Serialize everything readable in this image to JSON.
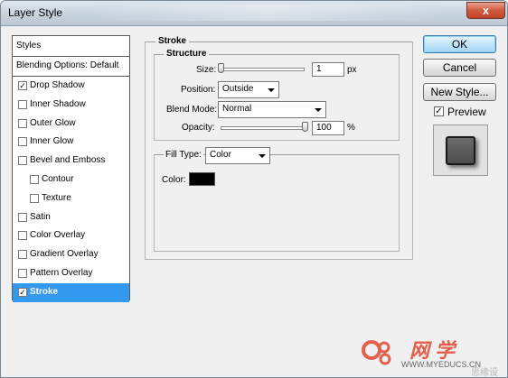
{
  "window": {
    "title": "Layer Style",
    "close_glyph": "x"
  },
  "styles_list": {
    "header": "Styles",
    "blending_options": "Blending Options: Default",
    "items": [
      {
        "label": "Drop Shadow",
        "checked": true,
        "sub": false,
        "selected": false
      },
      {
        "label": "Inner Shadow",
        "checked": false,
        "sub": false,
        "selected": false
      },
      {
        "label": "Outer Glow",
        "checked": false,
        "sub": false,
        "selected": false
      },
      {
        "label": "Inner Glow",
        "checked": false,
        "sub": false,
        "selected": false
      },
      {
        "label": "Bevel and Emboss",
        "checked": false,
        "sub": false,
        "selected": false
      },
      {
        "label": "Contour",
        "checked": false,
        "sub": true,
        "selected": false
      },
      {
        "label": "Texture",
        "checked": false,
        "sub": true,
        "selected": false
      },
      {
        "label": "Satin",
        "checked": false,
        "sub": false,
        "selected": false
      },
      {
        "label": "Color Overlay",
        "checked": false,
        "sub": false,
        "selected": false
      },
      {
        "label": "Gradient Overlay",
        "checked": false,
        "sub": false,
        "selected": false
      },
      {
        "label": "Pattern Overlay",
        "checked": false,
        "sub": false,
        "selected": false
      },
      {
        "label": "Stroke",
        "checked": true,
        "sub": false,
        "selected": true
      }
    ]
  },
  "stroke": {
    "title": "Stroke",
    "structure": {
      "title": "Structure",
      "size_label": "Size:",
      "size_value": "1",
      "size_unit": "px",
      "position_label": "Position:",
      "position_value": "Outside",
      "blend_mode_label": "Blend Mode:",
      "blend_mode_value": "Normal",
      "opacity_label": "Opacity:",
      "opacity_value": "100",
      "opacity_unit": "%"
    },
    "fill": {
      "fill_type_label": "Fill Type:",
      "fill_type_value": "Color",
      "color_label": "Color:",
      "color_value": "#000000"
    }
  },
  "buttons": {
    "ok": "OK",
    "cancel": "Cancel",
    "new_style": "New Style...",
    "preview_label": "Preview",
    "preview_checked": true
  },
  "watermark": {
    "brand": "网 学",
    "url": "WWW.MYEDUCS.CN",
    "url2": "思缘设计.COM"
  },
  "colors": {
    "selection": "#3398f0",
    "accent_button": "#bfe4f9",
    "close_button": "#cf5a3e"
  }
}
